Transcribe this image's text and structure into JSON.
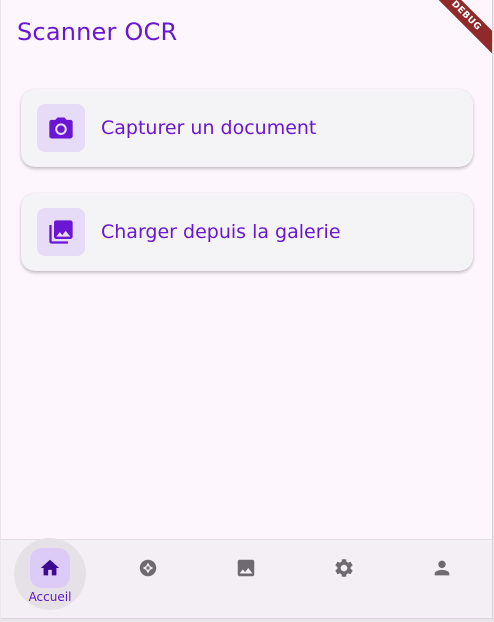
{
  "app": {
    "title": "Scanner OCR",
    "debug_banner": "DEBUG"
  },
  "actions": [
    {
      "label": "Capturer un document",
      "icon": "camera-icon"
    },
    {
      "label": "Charger depuis la galerie",
      "icon": "photo-library-icon"
    }
  ],
  "bottom_nav": {
    "selected": "Accueil",
    "items": [
      {
        "label": "Accueil",
        "icon": "home-icon"
      },
      {
        "label": "",
        "icon": "camera-shutter-icon"
      },
      {
        "label": "",
        "icon": "photo-icon"
      },
      {
        "label": "",
        "icon": "gear-icon"
      },
      {
        "label": "",
        "icon": "person-icon"
      }
    ]
  },
  "colors": {
    "accent": "#6a16d3",
    "background": "#fdf6fd",
    "card": "#f4f3f5",
    "icon_tile": "#e7dcf7",
    "nav_indicator": "#dccbf6",
    "nav_icon": "#6e6a72"
  }
}
